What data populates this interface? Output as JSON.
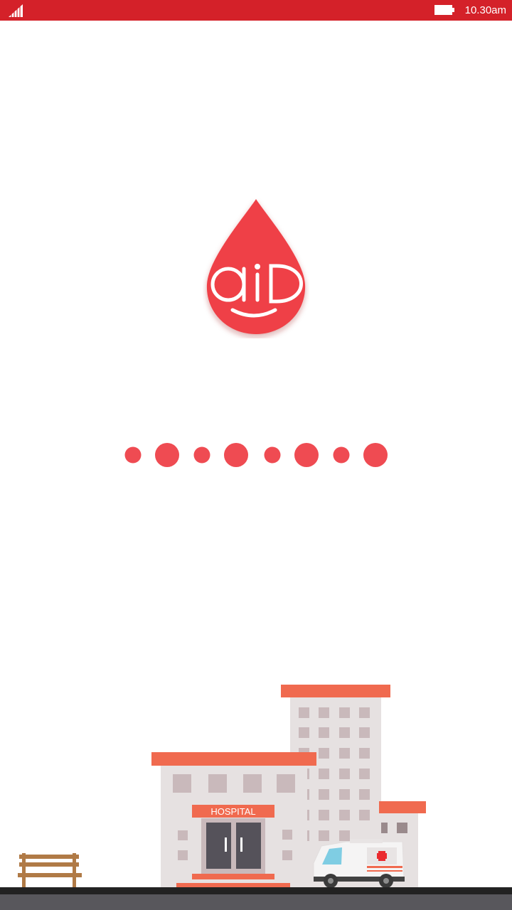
{
  "status_bar": {
    "time": "10.30am",
    "signal_icon": "signal-bars-icon",
    "battery_icon": "battery-icon",
    "color": "#d42129"
  },
  "splash": {
    "logo_text": "aiD",
    "logo_icon": "blood-drop-logo-icon",
    "drop_color": "#ef4146",
    "loading_dot_color": "#ef4b52",
    "loading_dots_count": 8
  },
  "illustration": {
    "hospital_sign": "HOSPITAL",
    "accent_color": "#f06a4f",
    "building_color": "#e6e1e1",
    "window_color": "#c9b9bb"
  }
}
